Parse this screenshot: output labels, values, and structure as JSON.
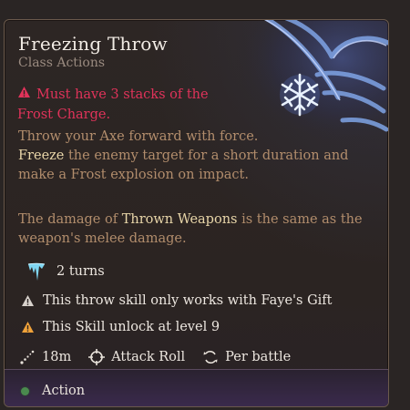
{
  "tooltip": {
    "title": "Freezing Throw",
    "category": "Class Actions",
    "requirement": {
      "prefix": "Must have 3 stacks of the ",
      "highlight": "Frost Charge",
      "suffix": "."
    },
    "description1": {
      "line1": "Throw your Axe forward with force.",
      "keyword": "Freeze",
      "rest": " the enemy target for a short duration and make a Frost explosion on impact."
    },
    "description2": {
      "prefix": "The damage of ",
      "keyword": "Thrown Weapons",
      "suffix": " is the same as the weapon's melee damage."
    },
    "duration": "2 turns",
    "notes": [
      "This throw skill only works with Faye's Gift",
      "This Skill unlock at level 9"
    ],
    "stats": {
      "range": "18m",
      "roll": "Attack Roll",
      "usage": "Per battle"
    },
    "action_type": "Action"
  },
  "colors": {
    "requirement": "#e0335a",
    "highlight": "#e8d4a2",
    "description": "#b28d6c",
    "action_dot": "#4a8a4e"
  },
  "icons": [
    "freezing-throw-art",
    "snowflake-icon",
    "warning-red-icon",
    "ice-claw-icon",
    "warning-grey-icon",
    "warning-orange-icon",
    "range-icon",
    "crosshair-icon",
    "cycle-icon",
    "action-dot-icon"
  ]
}
